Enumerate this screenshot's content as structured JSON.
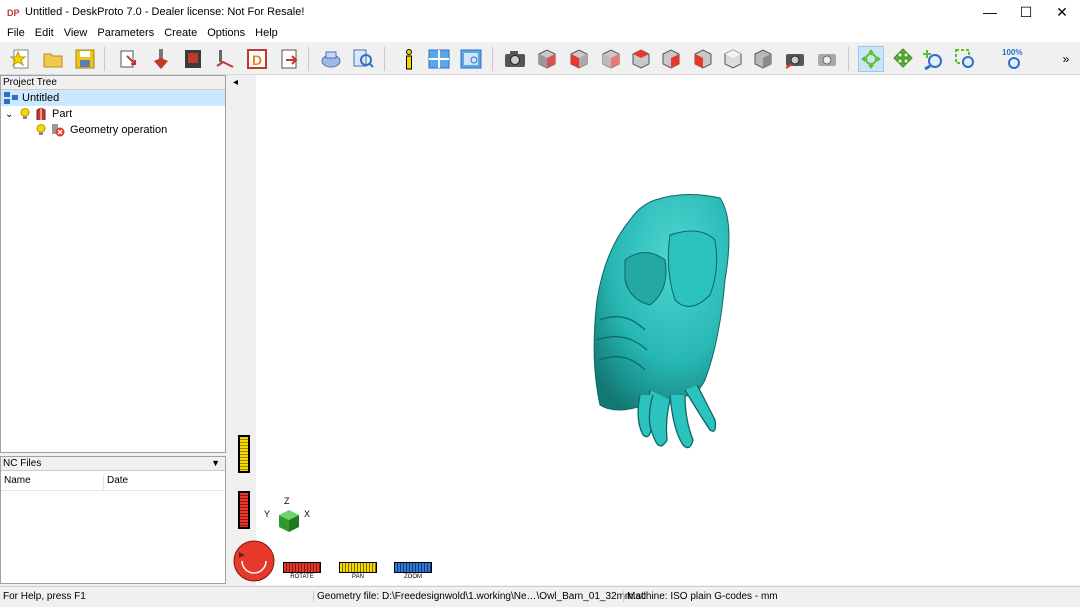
{
  "window": {
    "title": "Untitled - DeskProto 7.0 - Dealer license: Not For Resale!",
    "app_icon_text": "DP",
    "minimize": "—",
    "maximize": "☐",
    "close": "✕"
  },
  "menu": [
    "File",
    "Edit",
    "View",
    "Parameters",
    "Create",
    "Options",
    "Help"
  ],
  "toolbar": {
    "zoom_100_label": "100%",
    "overflow": "»"
  },
  "project_tree": {
    "header": "Project Tree",
    "root": "Untitled",
    "part": "Part",
    "operation": "Geometry operation",
    "expander": "⌄"
  },
  "nc_files": {
    "header": "NC Files",
    "columns": [
      "Name",
      "Date"
    ]
  },
  "viewport": {
    "collapse_arrow": "◂",
    "axes": {
      "x": "X",
      "y": "Y",
      "z": "Z"
    },
    "nav_labels": {
      "rotate": "ROTATE",
      "pan": "PAN",
      "zoom": "ZOOM"
    },
    "model_color": "#27b7b3"
  },
  "status": {
    "help": "For Help, press F1",
    "geometry": "Geometry file: D:\\Freedesignwold\\1.working\\Ne…\\Owl_Barn_01_32mm.stl",
    "machine": "Machine: ISO plain G-codes - mm"
  },
  "colors": {
    "accent_red": "#e8372b",
    "accent_yellow": "#e8d800",
    "accent_blue": "#2f7bd6",
    "selection": "#cce8ff"
  }
}
